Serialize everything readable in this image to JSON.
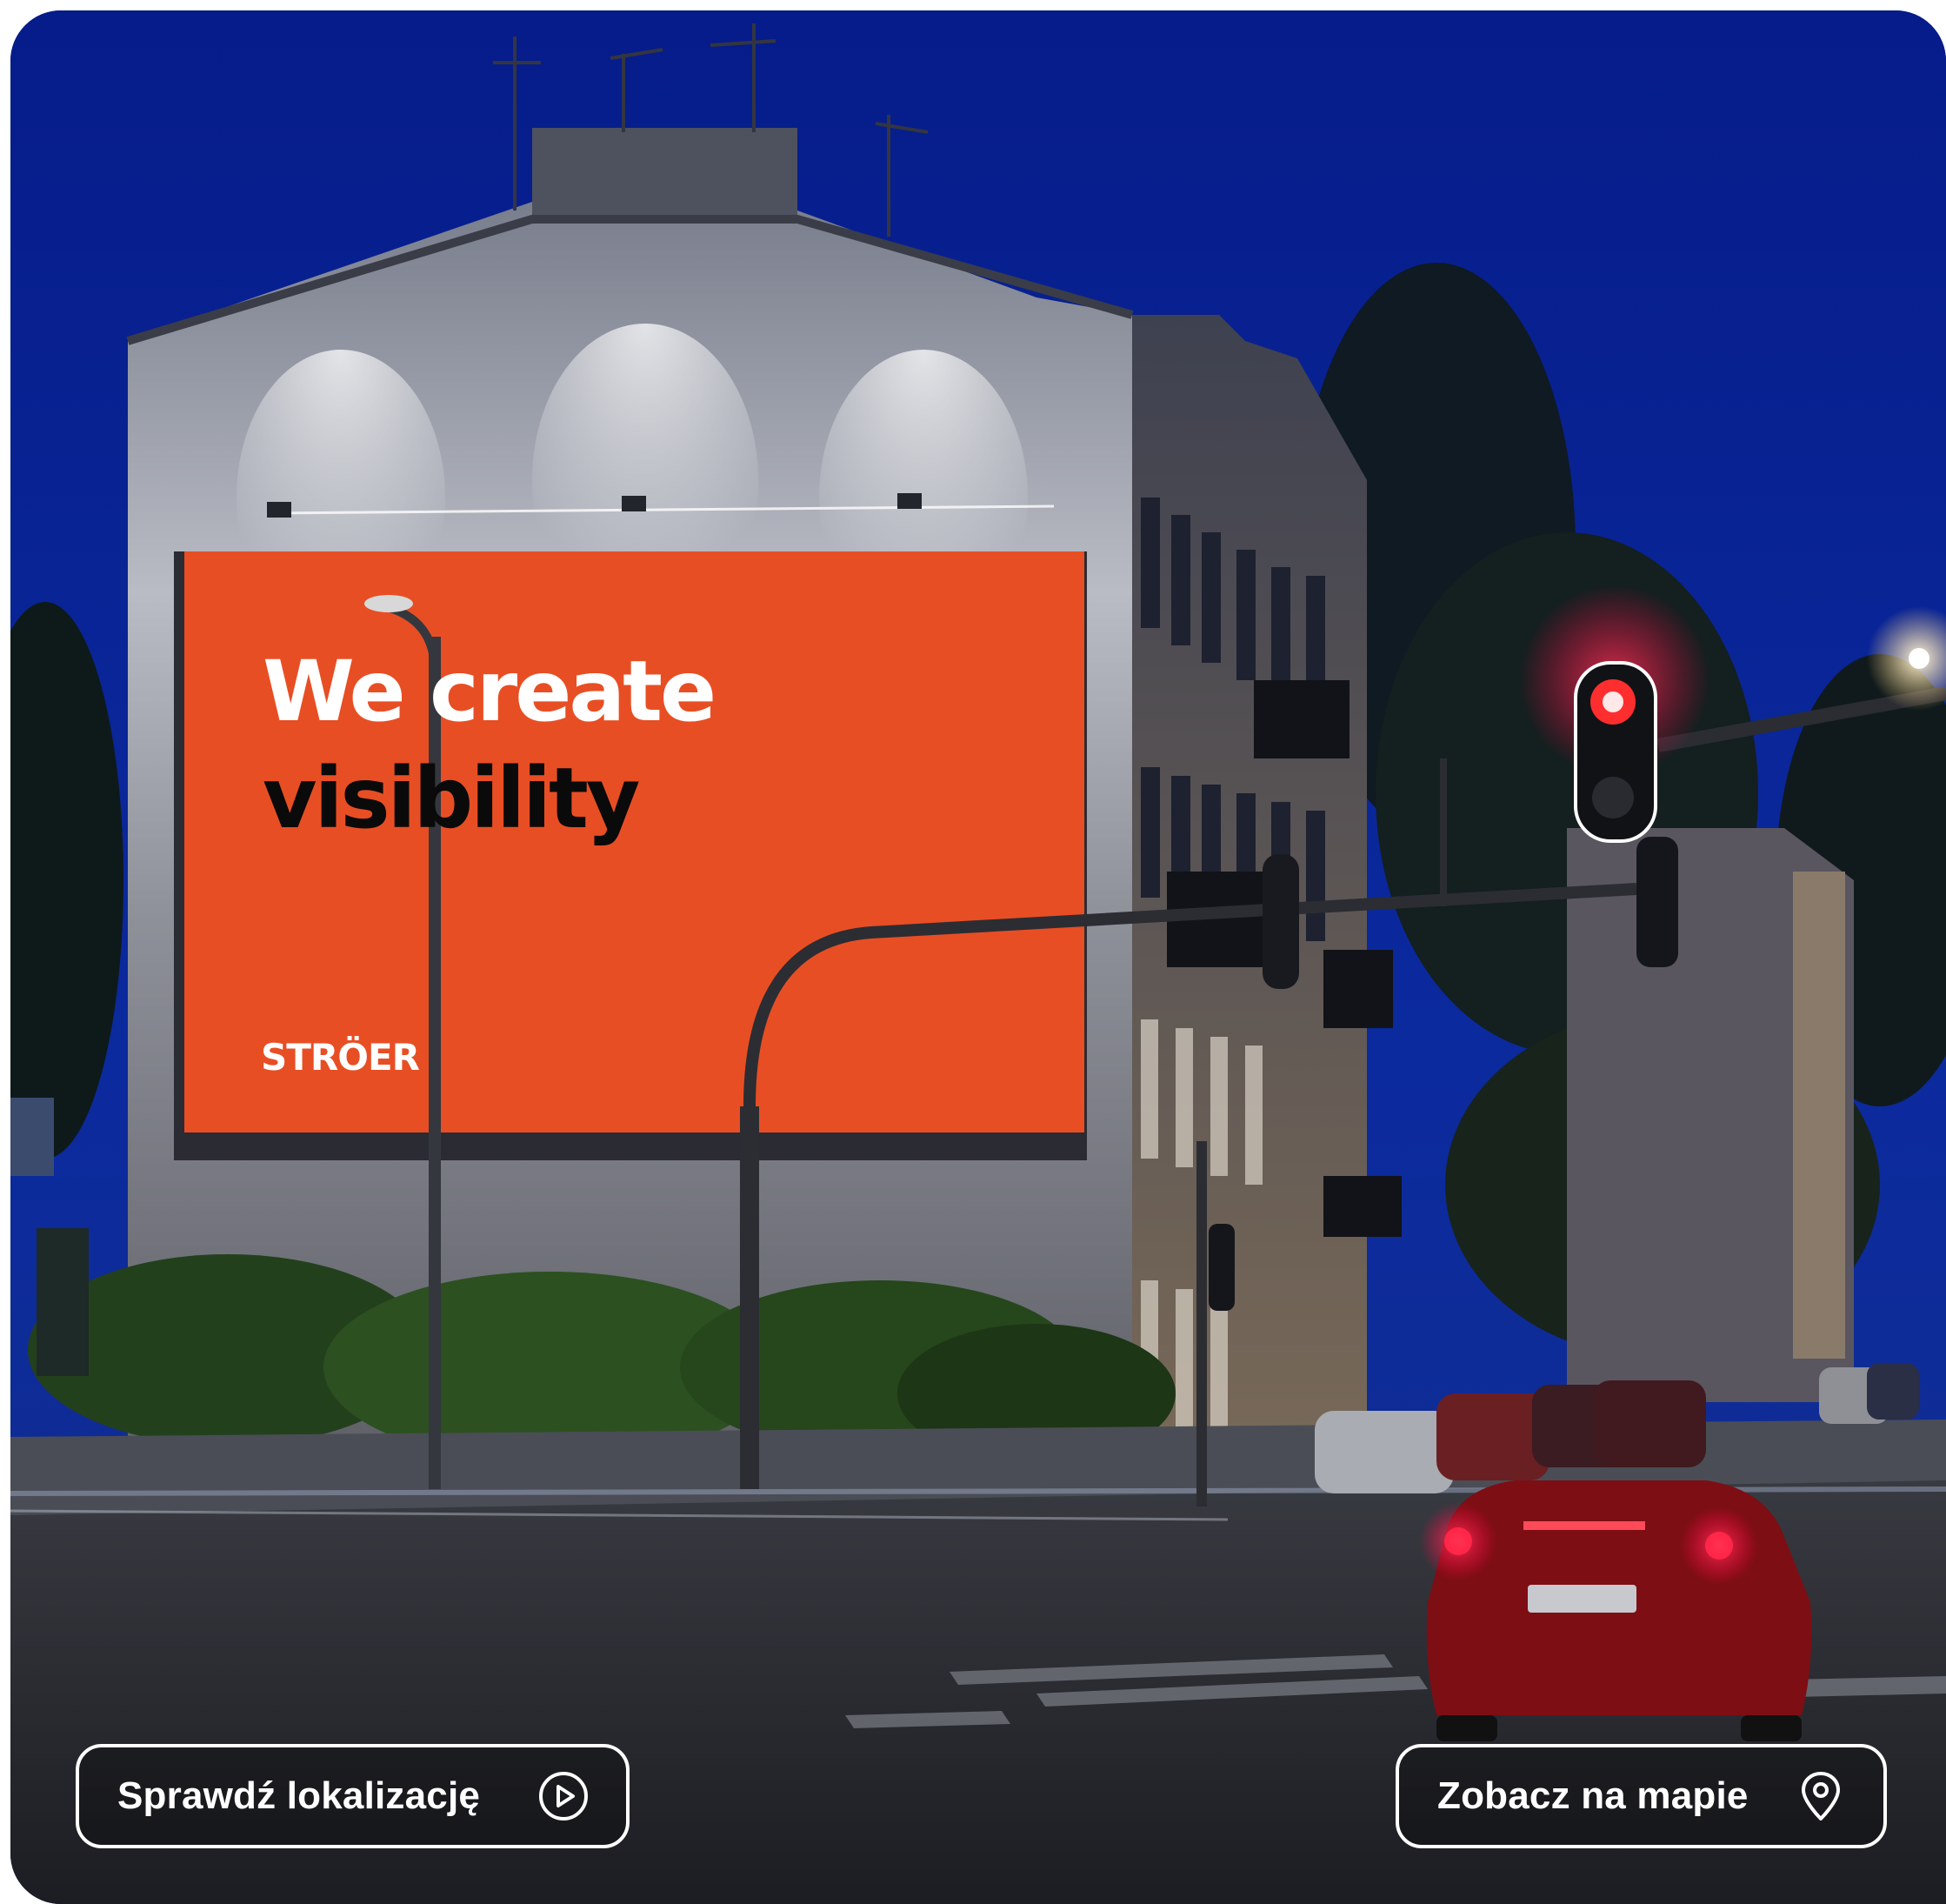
{
  "photo": {
    "billboard": {
      "headline_line1": "We create",
      "headline_line2": "visibility",
      "brand": "STRÖER",
      "color": "#e84e24"
    },
    "sky_color": "#0b2a9e"
  },
  "actions": {
    "check_location": {
      "label": "Sprawdź lokalizację",
      "icon": "play-circle-icon"
    },
    "view_on_map": {
      "label": "Zobacz na mapie",
      "icon": "map-pin-icon"
    }
  }
}
